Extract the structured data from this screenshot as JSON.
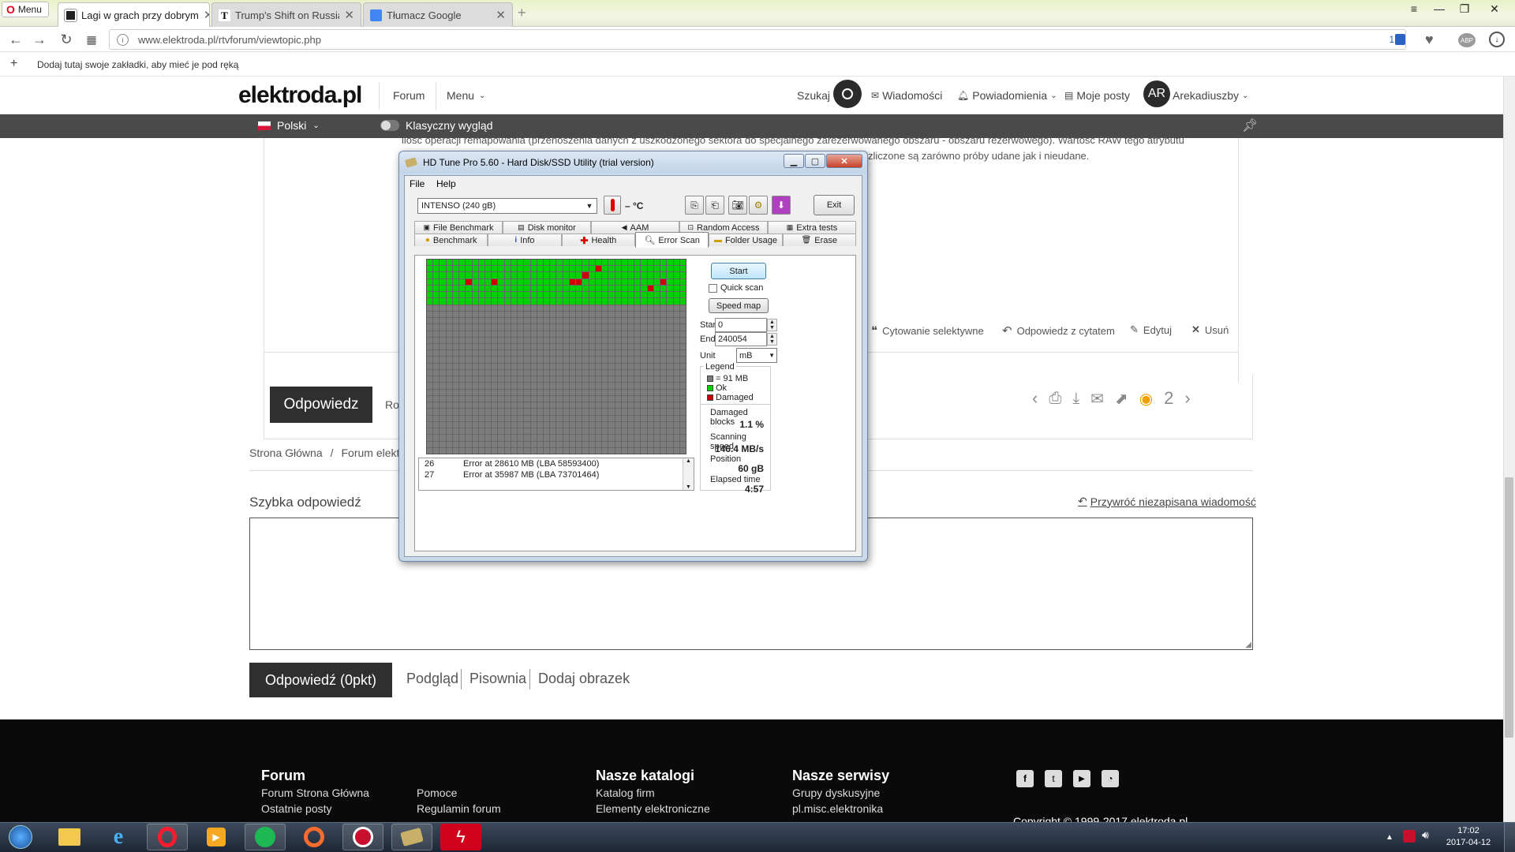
{
  "browser": {
    "menu_label": "Menu",
    "tabs": [
      {
        "label": "Lagi w grach przy dobrym",
        "active": true
      },
      {
        "label": "Trump's Shift on Russia Br",
        "active": false
      },
      {
        "label": "Tłumacz Google",
        "active": false
      }
    ],
    "new_tab": "+",
    "window_controls": {
      "menu": "≡",
      "minimize": "—",
      "restore": "❐",
      "close": "✕"
    },
    "url": "www.elektroda.pl/rtvforum/viewtopic.php",
    "badge_count": "1",
    "bookmarks_hint": "Dodaj tutaj swoje zakładki, aby mieć je pod ręką",
    "adblock": "ABP"
  },
  "site": {
    "logo": "elektroda.pl",
    "nav": {
      "forum": "Forum",
      "menu": "Menu"
    },
    "search_label": "Szukaj",
    "messages": "Wiadomości",
    "notifications": "Powiadomienia",
    "my_posts": "Moje posty",
    "avatar_initials": "AR",
    "username": "Arekadiuszby",
    "language": "Polski",
    "classic_view": "Klasyczny wygląd"
  },
  "post": {
    "text_line1": "ilość operacji remapowania (przenoszenia danych z uszkodzonego sektora do specjalnego zarezerwowanego obszaru - obszaru rezerwowego). Wartość RAW tego atrybutu",
    "text_line2": "zliczone są zarówno próby udane jak i nieudane.",
    "actions": {
      "quote_selective": "Cytowanie selektywne",
      "reply_quote": "Odpowiedz z cytatem",
      "edit": "Edytuj",
      "delete": "Usuń"
    },
    "reply_button": "Odpowiedz",
    "partial_label": "Ro",
    "view_count": "2"
  },
  "breadcrumb": {
    "home": "Strona Główna",
    "separator": "/",
    "forum": "Forum elekt"
  },
  "quick_reply": {
    "title": "Szybka odpowiedź",
    "restore": "Przywróć niezapisana wiadomość",
    "send": "Odpowiedź (0pkt)",
    "preview": "Podgląd",
    "spelling": "Pisownia",
    "add_image": "Dodaj obrazek"
  },
  "footer": {
    "forum": {
      "title": "Forum",
      "links": [
        "Forum Strona Główna",
        "Ostatnie posty"
      ]
    },
    "help": {
      "links": [
        "Pomoce",
        "Regulamin forum"
      ]
    },
    "catalogs": {
      "title": "Nasze katalogi",
      "links": [
        "Katalog firm",
        "Elementy elektroniczne"
      ]
    },
    "services": {
      "title": "Nasze serwisy",
      "links": [
        "Grupy dyskusyjne",
        "pl.misc.elektronika"
      ]
    },
    "copyright": "Copyright © 1999-2017 elektroda.pl"
  },
  "taskbar": {
    "time": "17:02",
    "date": "2017-04-12"
  },
  "hdtune": {
    "title": "HD Tune Pro 5.60 - Hard Disk/SSD Utility (trial version)",
    "menu": {
      "file": "File",
      "help": "Help"
    },
    "drive": "INTENSO (240 gB)",
    "temp": "– °C",
    "exit": "Exit",
    "tabs_row1": [
      "File Benchmark",
      "Disk monitor",
      "AAM",
      "Random Access",
      "Extra tests"
    ],
    "tabs_row2": [
      "Benchmark",
      "Info",
      "Health",
      "Error Scan",
      "Folder Usage",
      "Erase"
    ],
    "active_tab": "Error Scan",
    "start": "Start",
    "quick_scan": "Quick scan",
    "speed_map": "Speed map",
    "start_label": "Start",
    "start_value": "0",
    "end_label": "End",
    "end_value": "240054",
    "unit_label": "Unit",
    "unit_value": "mB",
    "legend": {
      "title": "Legend",
      "block": "= 91 MB",
      "ok": "Ok",
      "damaged": "Damaged"
    },
    "stats": {
      "damaged_label": "Damaged blocks",
      "damaged_value": "1.1 %",
      "speed_label": "Scanning speed",
      "speed_value": "146.4 MB/s",
      "position_label": "Position",
      "position_value": "60 gB",
      "elapsed_label": "Elapsed time",
      "elapsed_value": "4:57"
    },
    "log": [
      {
        "n": "26",
        "msg": "Error at 28610 MB (LBA 58593400)"
      },
      {
        "n": "27",
        "msg": "Error at 35987 MB (LBA 73701464)"
      }
    ],
    "grid": {
      "columns": 40,
      "rows": 30,
      "scanned_rows": 7,
      "damaged_cells": [
        [
          1,
          26
        ],
        [
          3,
          6
        ],
        [
          3,
          10
        ],
        [
          3,
          22
        ],
        [
          3,
          23
        ],
        [
          4,
          34
        ],
        [
          3,
          36
        ],
        [
          2,
          24
        ]
      ]
    },
    "colors": {
      "ok": "#00d000",
      "damaged": "#cc0000",
      "unscanned": "#7c7c7c"
    }
  }
}
